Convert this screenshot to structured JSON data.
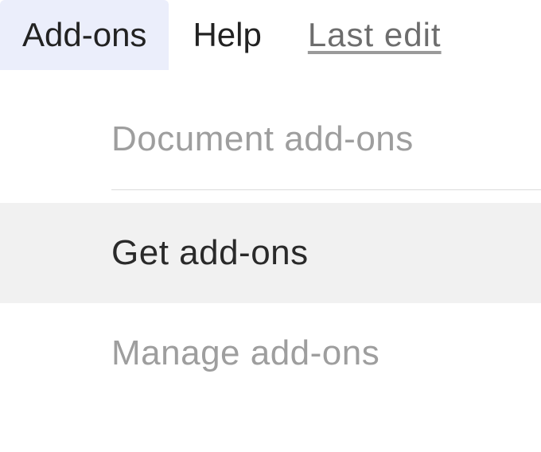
{
  "menubar": {
    "addons_label": "Add-ons",
    "help_label": "Help",
    "last_edit_label": "Last edit "
  },
  "dropdown": {
    "header_label": "Document add-ons",
    "get_addons_label": "Get add-ons",
    "manage_addons_label": "Manage add-ons"
  }
}
